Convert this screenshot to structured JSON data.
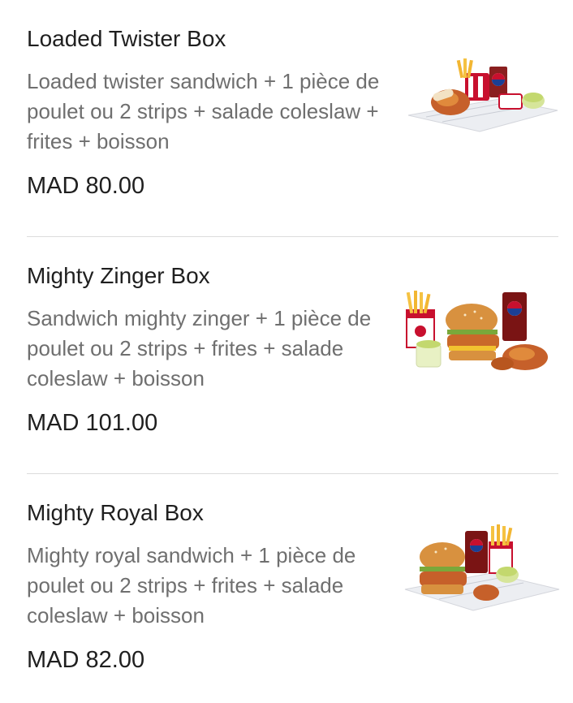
{
  "items": [
    {
      "title": "Loaded Twister Box",
      "description": "Loaded twister sandwich + 1 pièce de poulet ou 2 strips + salade coleslaw + frites + boisson",
      "price": "MAD 80.00",
      "image_icon": "loaded-twister-box-photo"
    },
    {
      "title": "Mighty Zinger Box",
      "description": "Sandwich mighty zinger + 1 pièce de poulet ou 2 strips + frites + salade coleslaw + boisson",
      "price": "MAD 101.00",
      "image_icon": "mighty-zinger-box-photo"
    },
    {
      "title": "Mighty Royal Box",
      "description": "Mighty royal sandwich + 1 pièce de poulet ou 2 strips + frites + salade coleslaw + boisson",
      "price": "MAD 82.00",
      "image_icon": "mighty-royal-box-photo"
    }
  ],
  "colors": {
    "title": "#1f1f1f",
    "description": "#6f6f6f",
    "divider": "#dcdcdc",
    "brand_red": "#c8102e",
    "pepsi_blue": "#1b3f95"
  }
}
